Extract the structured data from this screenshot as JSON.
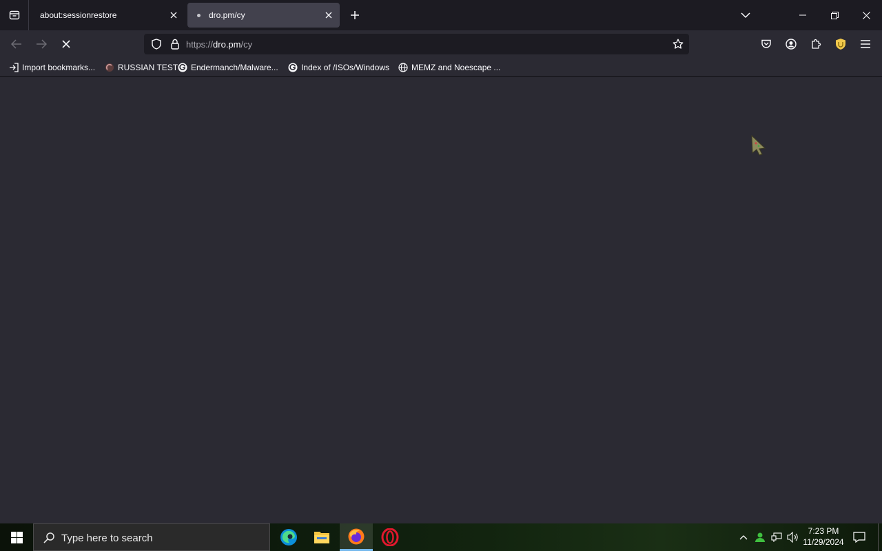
{
  "tabs": [
    {
      "label": "about:sessionrestore",
      "active": false
    },
    {
      "label": "dro.pm/cy",
      "active": true,
      "loading": true
    }
  ],
  "address_bar": {
    "scheme": "https://",
    "host": "dro.pm",
    "path": "/cy"
  },
  "bookmarks": [
    {
      "label": "Import bookmarks...",
      "icon": "import-icon"
    },
    {
      "label": "RUSSIAN TEST",
      "icon": "site-favicon"
    },
    {
      "label": "Endermanch/Malware...",
      "icon": "google-icon"
    },
    {
      "label": "Index of /ISOs/Windows",
      "icon": "google-icon"
    },
    {
      "label": "MEMZ and Noescape ...",
      "icon": "globe-icon"
    }
  ],
  "taskbar": {
    "search_placeholder": "Type here to search",
    "apps": [
      "edge-icon",
      "file-explorer-icon",
      "firefox-icon",
      "opera-icon"
    ],
    "clock_time": "7:23 PM",
    "clock_date": "11/29/2024"
  },
  "colors": {
    "page_bg": "#2b2a33",
    "tabbar_bg": "#1c1b22",
    "accent": "#76b9ed"
  }
}
